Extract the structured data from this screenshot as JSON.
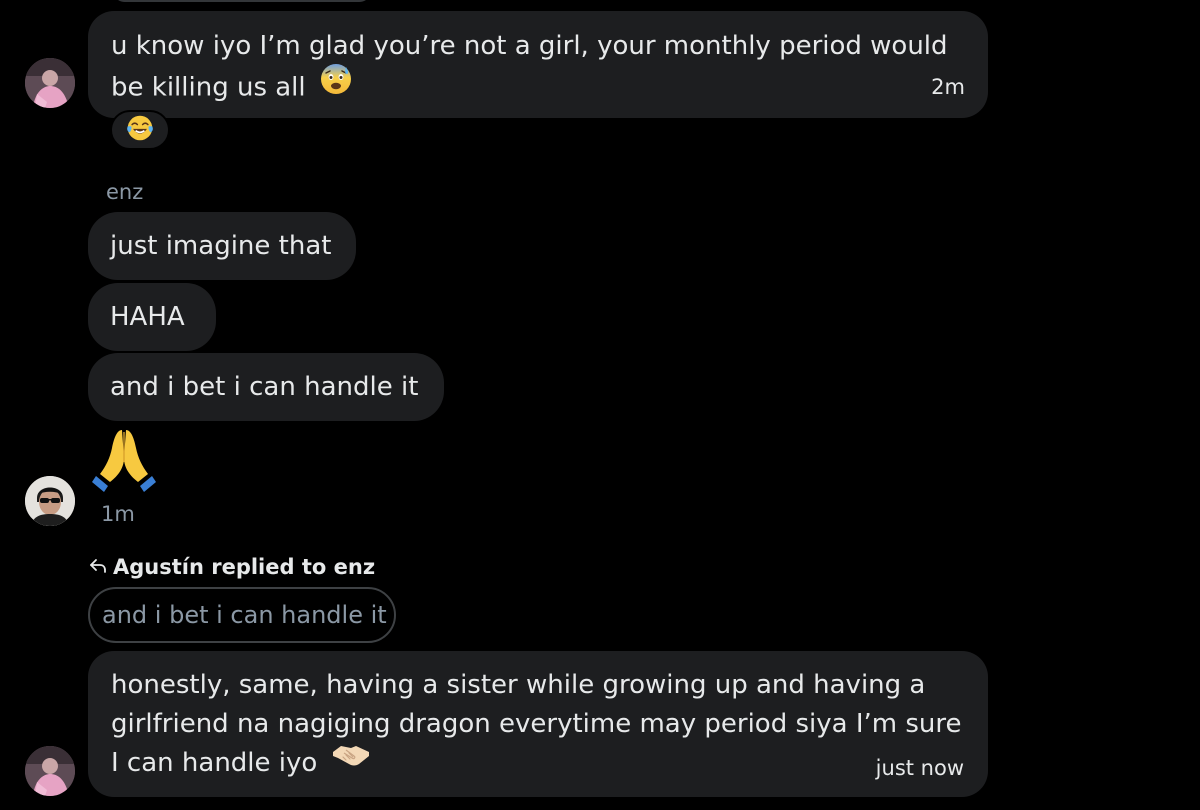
{
  "messages": {
    "first": {
      "line1": "u know iyo I’m glad you’re not a girl, your monthly period would",
      "line2": "be killing us all",
      "emoji": "anxious-face-with-sweat",
      "time": "2m",
      "reaction": "face-with-tears-of-joy"
    },
    "enz_group": {
      "sender": "enz",
      "msg1": "just imagine that",
      "msg2": "HAHA",
      "msg3": "and i bet i can handle it",
      "emoji": "folded-hands",
      "time": "1m"
    },
    "reply": {
      "header": "Agustín replied to enz",
      "quoted": "and i bet i can handle it",
      "line1": "honestly, same, having a sister while growing up and having a",
      "line2": "girlfriend na nagiging dragon everytime may period siya I’m sure",
      "line3": "I can handle iyo",
      "emoji": "handshake",
      "time": "just now"
    }
  },
  "colors": {
    "background": "#000000",
    "bubble": "#1d1e20",
    "text": "#e7e9ea",
    "muted": "#8b98a5"
  }
}
